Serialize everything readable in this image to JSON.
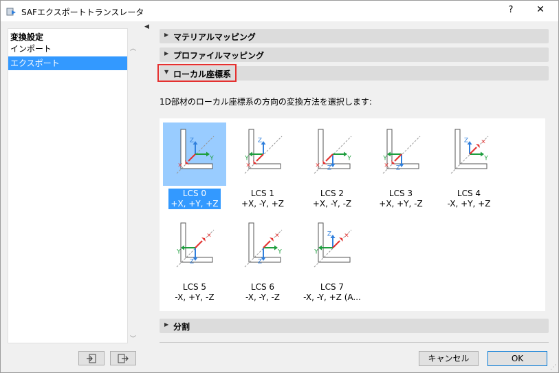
{
  "window": {
    "title": "SAFエクスポートトランスレータ",
    "help_label": "?",
    "close_label": "✕"
  },
  "sidebar": {
    "heading": "変換設定",
    "items": [
      {
        "label": "インポート",
        "selected": false
      },
      {
        "label": "エクスポート",
        "selected": true
      }
    ]
  },
  "sections": {
    "material": "マテリアルマッピング",
    "profile": "プロファイルマッピング",
    "local": "ローカル座標系",
    "split": "分割"
  },
  "description": "1D部材のローカル座標系の方向の変換方法を選択します:",
  "lcs_options": [
    {
      "name": "LCS 0",
      "axes": "+X, +Y, +Z",
      "selected": true
    },
    {
      "name": "LCS 1",
      "axes": "+X, -Y, +Z",
      "selected": false
    },
    {
      "name": "LCS 2",
      "axes": "+X, -Y, -Z",
      "selected": false
    },
    {
      "name": "LCS 3",
      "axes": "+X, +Y, -Z",
      "selected": false
    },
    {
      "name": "LCS 4",
      "axes": "-X, +Y, +Z",
      "selected": false
    },
    {
      "name": "LCS 5",
      "axes": "-X, +Y, -Z",
      "selected": false
    },
    {
      "name": "LCS 6",
      "axes": "-X, -Y, -Z",
      "selected": false
    },
    {
      "name": "LCS 7",
      "axes": "-X, -Y, +Z (A...",
      "selected": false
    }
  ],
  "axis_letters": {
    "x": "X",
    "y": "Y",
    "z": "Z"
  },
  "buttons": {
    "cancel": "キャンセル",
    "ok": "OK"
  },
  "icons": {
    "import": "import-settings-icon",
    "export": "export-settings-icon",
    "app": "translator-app-icon"
  },
  "colors": {
    "selection": "#3399ff",
    "selection_light": "#99ccff",
    "x_axis": "#e8312f",
    "y_axis": "#1e9e3e",
    "z_axis": "#2f7fdc",
    "highlight": "#e5302f"
  }
}
